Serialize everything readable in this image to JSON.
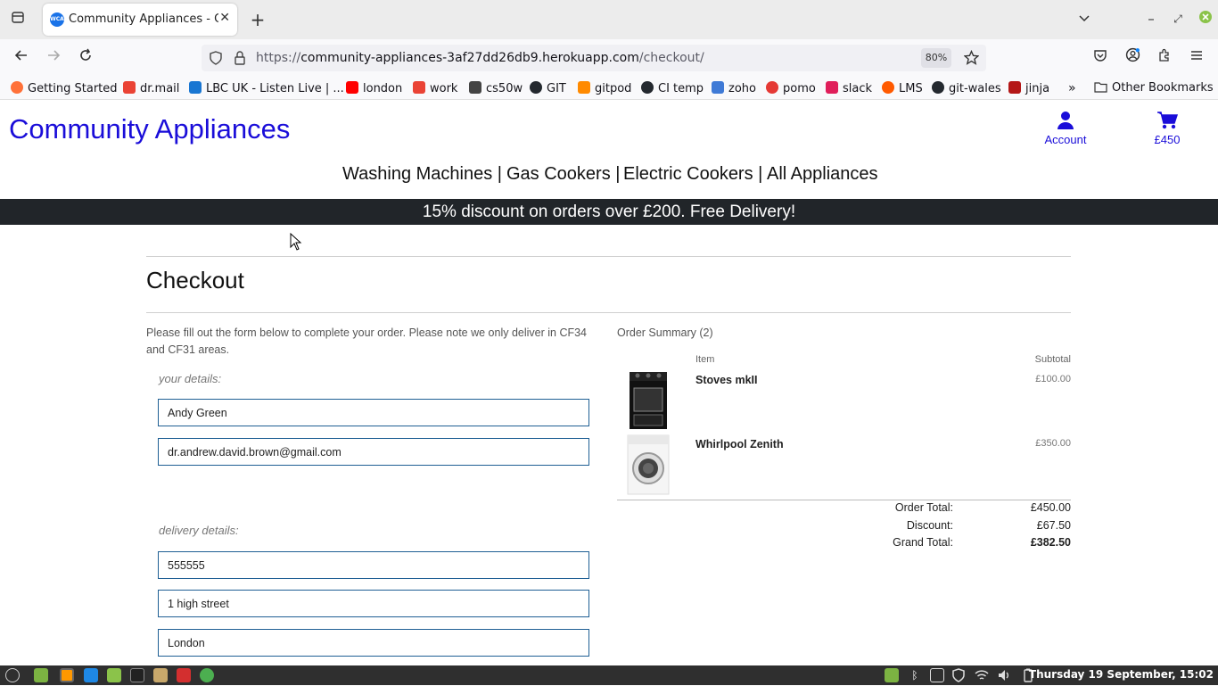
{
  "browser": {
    "tab_title": "Community Appliances - Checkout",
    "tab_favicon_text": "WCA",
    "url_prefix": "https://",
    "url_host": "community-appliances-3af27dd26db9.herokuapp.com",
    "url_path": "/checkout/",
    "zoom": "80%",
    "bookmarks": [
      "Getting Started",
      "dr.mail",
      "LBC UK - Listen Live | ...",
      "london",
      "work",
      "cs50w",
      "GIT",
      "gitpod",
      "CI temp",
      "zoho",
      "pomo",
      "slack",
      "LMS",
      "git-wales",
      "jinja"
    ],
    "other_bookmarks": "Other Bookmarks"
  },
  "site": {
    "brand": "Community Appliances",
    "account_label": "Account",
    "cart_total": "£450",
    "nav": [
      "Washing Machines |",
      "Gas Cookers |",
      "Electric Cookers |",
      "All Appliances"
    ],
    "banner": "15% discount on orders over £200. Free Delivery!"
  },
  "checkout": {
    "heading": "Checkout",
    "intro": "Please fill out the form below to complete your order. Please note we only deliver in CF34 and CF31 areas.",
    "your_details_legend": "your details:",
    "full_name": "Andy Green",
    "email": "dr.andrew.david.brown@gmail.com",
    "delivery_legend": "delivery details:",
    "phone": "555555",
    "street_address": "1 high street",
    "town": "London"
  },
  "summary": {
    "title": "Order Summary (2)",
    "col_item": "Item",
    "col_subtotal": "Subtotal",
    "items": [
      {
        "name": "Stoves mkII",
        "subtotal": "£100.00"
      },
      {
        "name": "Whirlpool Zenith",
        "subtotal": "£350.00"
      }
    ],
    "order_total_label": "Order Total:",
    "order_total": "£450.00",
    "discount_label": "Discount:",
    "discount": "£67.50",
    "grand_total_label": "Grand Total:",
    "grand_total": "£382.50"
  },
  "taskbar": {
    "clock": "Thursday 19 September, 15:02"
  }
}
